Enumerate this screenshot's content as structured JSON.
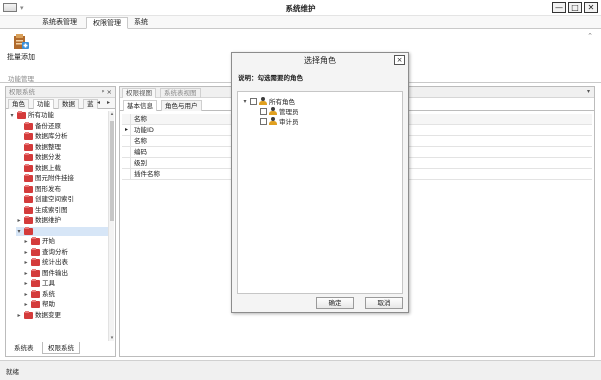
{
  "window": {
    "title": "系统维护",
    "controls": {
      "minimize": "—",
      "maximize": "□",
      "close": "✕"
    }
  },
  "ribbon": {
    "tabs": [
      {
        "label": "系统表管理"
      },
      {
        "label": "权限管理"
      },
      {
        "label": "系统"
      }
    ],
    "active_tab": "权限管理",
    "buttons": {
      "batch_add": "批量添加"
    },
    "group_label": "功能管理"
  },
  "left_panel": {
    "title": "权限系统",
    "tabs": [
      {
        "label": "角色"
      },
      {
        "label": "功能"
      },
      {
        "label": "数据"
      },
      {
        "label": "蓝"
      }
    ],
    "active_tab": "功能",
    "tree": [
      {
        "label": "所有功能",
        "level": 0,
        "expander": "▾"
      },
      {
        "label": "备份还原",
        "level": 1,
        "expander": ""
      },
      {
        "label": "数据库分析",
        "level": 1,
        "expander": ""
      },
      {
        "label": "数据整理",
        "level": 1,
        "expander": ""
      },
      {
        "label": "数据分发",
        "level": 1,
        "expander": ""
      },
      {
        "label": "数据上载",
        "level": 1,
        "expander": ""
      },
      {
        "label": "图元附件挂接",
        "level": 1,
        "expander": ""
      },
      {
        "label": "图形发布",
        "level": 1,
        "expander": ""
      },
      {
        "label": "创建空间索引",
        "level": 1,
        "expander": ""
      },
      {
        "label": "生成索引图",
        "level": 1,
        "expander": ""
      },
      {
        "label": "数据维护",
        "level": 1,
        "expander": "▸"
      },
      {
        "label": "",
        "level": 1,
        "expander": "▾",
        "selected": true
      },
      {
        "label": "开始",
        "level": 2,
        "expander": "▸"
      },
      {
        "label": "查询分析",
        "level": 2,
        "expander": "▸"
      },
      {
        "label": "统计出表",
        "level": 2,
        "expander": "▸"
      },
      {
        "label": "图件输出",
        "level": 2,
        "expander": "▸"
      },
      {
        "label": "工具",
        "level": 2,
        "expander": "▸"
      },
      {
        "label": "系统",
        "level": 2,
        "expander": "▸"
      },
      {
        "label": "帮助",
        "level": 2,
        "expander": "▸"
      },
      {
        "label": "数据变更",
        "level": 1,
        "expander": "▸"
      }
    ],
    "bottom_tabs": [
      {
        "label": "系统表"
      },
      {
        "label": "权限系统"
      }
    ],
    "active_bottom_tab": "权限系统"
  },
  "doc_tabs": [
    {
      "label": "权限视图"
    },
    {
      "label": "系统表视图"
    }
  ],
  "inner_tabs": [
    {
      "label": "基本信息"
    },
    {
      "label": "角色与用户"
    }
  ],
  "grid": {
    "header": "名称",
    "rows": [
      {
        "label": "功能ID",
        "marker": "▸"
      },
      {
        "label": "名称",
        "marker": ""
      },
      {
        "label": "编码",
        "marker": ""
      },
      {
        "label": "级别",
        "marker": ""
      },
      {
        "label": "插件名称",
        "marker": ""
      }
    ]
  },
  "dialog": {
    "title": "选择角色",
    "close": "×",
    "description": "说明：勾选需要的角色",
    "tree": [
      {
        "label": "所有角色",
        "level": 0,
        "expander": "▾"
      },
      {
        "label": "管理员",
        "level": 1,
        "expander": ""
      },
      {
        "label": "审计员",
        "level": 1,
        "expander": ""
      }
    ],
    "ok": "确定",
    "cancel": "取消"
  },
  "status": {
    "text": "就绪"
  }
}
